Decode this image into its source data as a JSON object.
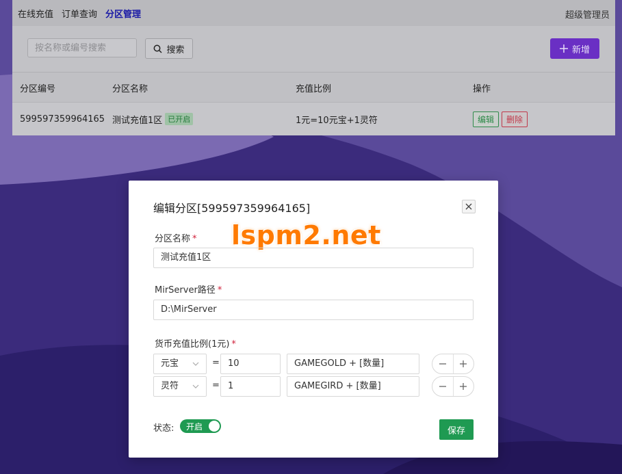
{
  "nav": {
    "items": [
      "在线充值",
      "订单查询",
      "分区管理"
    ],
    "active_index": 2,
    "admin": "超级管理员"
  },
  "toolbar": {
    "search_placeholder": "按名称或编号搜索",
    "search_label": "搜索",
    "add_label": "新增"
  },
  "table": {
    "headers": [
      "分区编号",
      "分区名称",
      "充值比例",
      "操作"
    ],
    "rows": [
      {
        "id": "599597359964165",
        "name": "测试充值1区",
        "status": "已开启",
        "ratio": "1元=10元宝+1灵符",
        "edit": "编辑",
        "delete": "删除"
      }
    ]
  },
  "modal": {
    "title": "编辑分区[599597359964165]",
    "watermark": "lspm2.net",
    "name_label": "分区名称",
    "name_value": "测试充值1区",
    "path_label": "MirServer路径",
    "path_value": "D:\\MirServer",
    "ratio_label": "货币充值比例(1元)",
    "required_mark": "*",
    "equals": "=",
    "rates": [
      {
        "currency": "元宝",
        "amount": "10",
        "expr": "GAMEGOLD + [数量]"
      },
      {
        "currency": "灵符",
        "amount": "1",
        "expr": "GAMEGIRD + [数量]"
      }
    ],
    "status_label": "状态:",
    "status_toggle": "开启",
    "status_on": true,
    "save_label": "保存"
  },
  "colors": {
    "accent": "#6a2fc4",
    "success": "#1f9a52",
    "danger": "#c0384a",
    "watermark": "#ff7a00"
  }
}
